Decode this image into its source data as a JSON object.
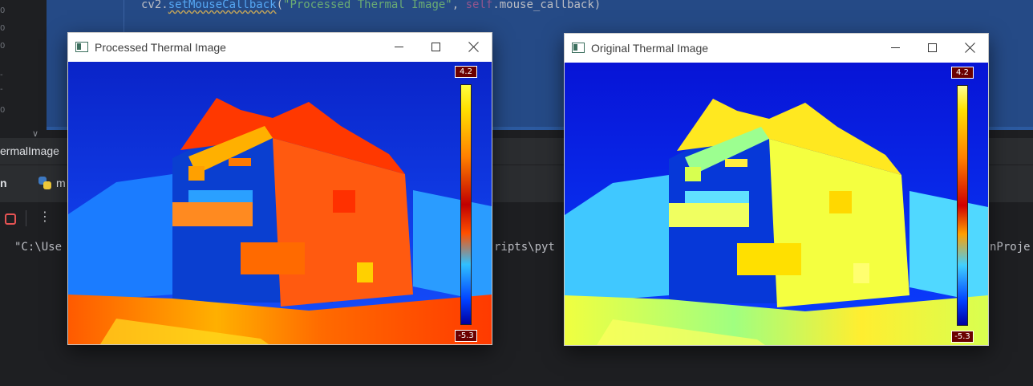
{
  "editor": {
    "code_line": {
      "obj": "cv2.",
      "fn": "setMouseCallback",
      "open": "(",
      "str": "\"Processed Thermal Image\"",
      "sep": ", ",
      "self": "self",
      "rest": ".mouse_callback)"
    },
    "gutter_marks": [
      "0",
      "0",
      "0",
      "-",
      "-",
      "0"
    ]
  },
  "run_panel": {
    "tab_title": "ermalImage",
    "run_label": "n",
    "file_tab_label": "m",
    "console_prefix": "\"C:\\Use",
    "console_middle": "ripts\\pyt",
    "console_suffix": "nProje"
  },
  "windows": {
    "processed": {
      "title": "Processed Thermal Image",
      "scale_max": "4.2",
      "scale_min": "-5.3",
      "colors": {
        "sky": "#0a24c8",
        "hot": "#ff3a00",
        "mid": "#1e90ff",
        "warm": "#ffd400"
      }
    },
    "original": {
      "title": "Original Thermal Image",
      "scale_max": "4.2",
      "scale_min": "-5.3",
      "colors": {
        "sky": "#0714d6",
        "hot": "#f5ff3a",
        "mid": "#22c4ff",
        "warm": "#ffe200"
      }
    }
  }
}
